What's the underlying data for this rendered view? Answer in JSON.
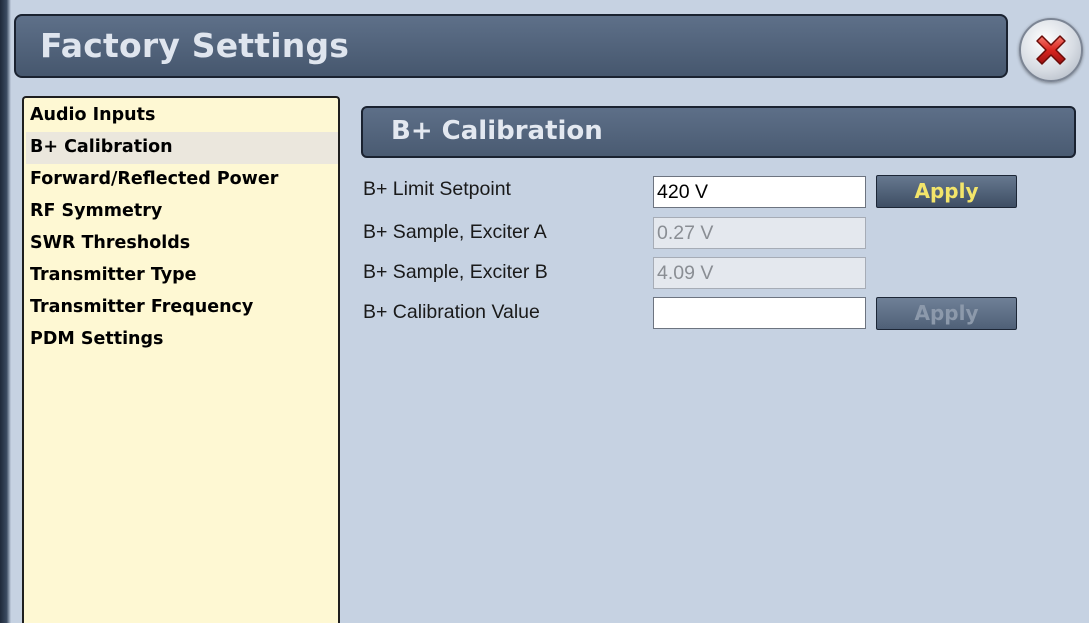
{
  "window": {
    "title": "Factory Settings",
    "close_icon": "close-x-icon"
  },
  "nav": {
    "selected_index": 1,
    "items": [
      {
        "label": "Audio Inputs"
      },
      {
        "label": "B+ Calibration"
      },
      {
        "label": "Forward/Reflected Power"
      },
      {
        "label": "RF Symmetry"
      },
      {
        "label": "SWR Thresholds"
      },
      {
        "label": "Transmitter Type"
      },
      {
        "label": "Transmitter Frequency"
      },
      {
        "label": "PDM Settings"
      }
    ]
  },
  "section": {
    "title": "B+ Calibration"
  },
  "fields": {
    "limit_setpoint": {
      "label": "B+ Limit Setpoint",
      "value": "420 V",
      "apply_label": "Apply",
      "editable": true
    },
    "sample_a": {
      "label": "B+ Sample, Exciter A",
      "value": "0.27 V",
      "editable": false
    },
    "sample_b": {
      "label": "B+ Sample, Exciter B",
      "value": "4.09 V",
      "editable": false
    },
    "calibration_value": {
      "label": "B+ Calibration Value",
      "value": "",
      "apply_label": "Apply",
      "apply_enabled": false,
      "editable": true
    }
  },
  "colors": {
    "background": "#c6d2e2",
    "nav_background": "#fef8d3",
    "header": "#4f6078",
    "apply_text": "#f3e56a",
    "close_red": "#d9251f"
  }
}
